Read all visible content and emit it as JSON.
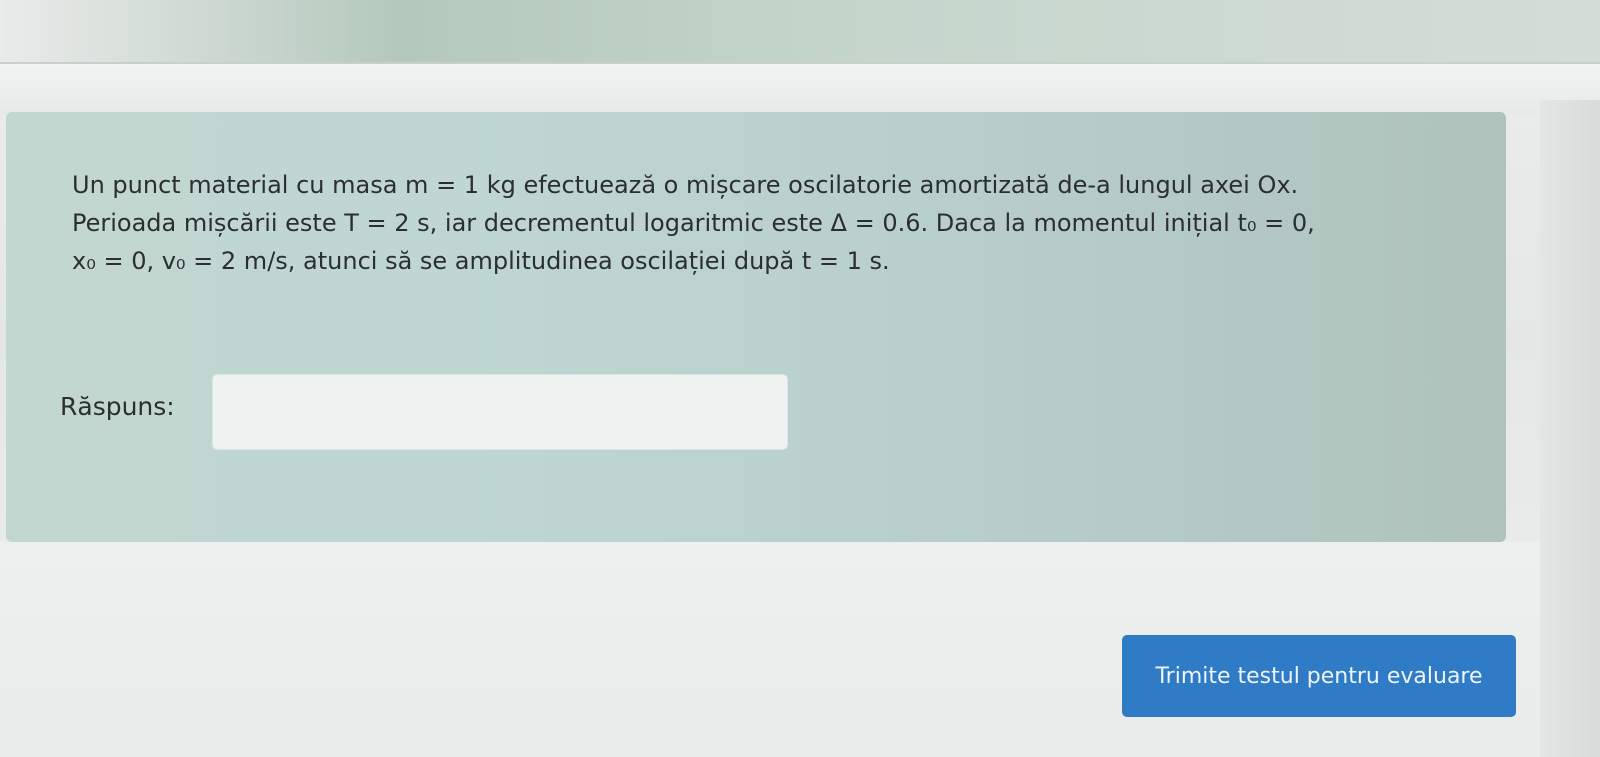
{
  "question": {
    "line1": "Un punct material cu masa m = 1 kg efectuează o mișcare oscilatorie amortizată de-a lungul axei Ox.",
    "line2": "Perioada mișcării este T = 2 s, iar decrementul logaritmic este Δ = 0.6. Daca la momentul inițial t₀ = 0,",
    "line3": "x₀ = 0, v₀ = 2 m/s, atunci să se amplitudinea oscilației după t = 1 s."
  },
  "answer": {
    "label": "Răspuns:",
    "value": "",
    "placeholder": ""
  },
  "submit": {
    "label": "Trimite testul pentru evaluare"
  },
  "colors": {
    "card_background": "#c0d6d0",
    "button_background": "#2f7bc6",
    "button_text": "#eef4fb",
    "text": "#2b2f30"
  }
}
